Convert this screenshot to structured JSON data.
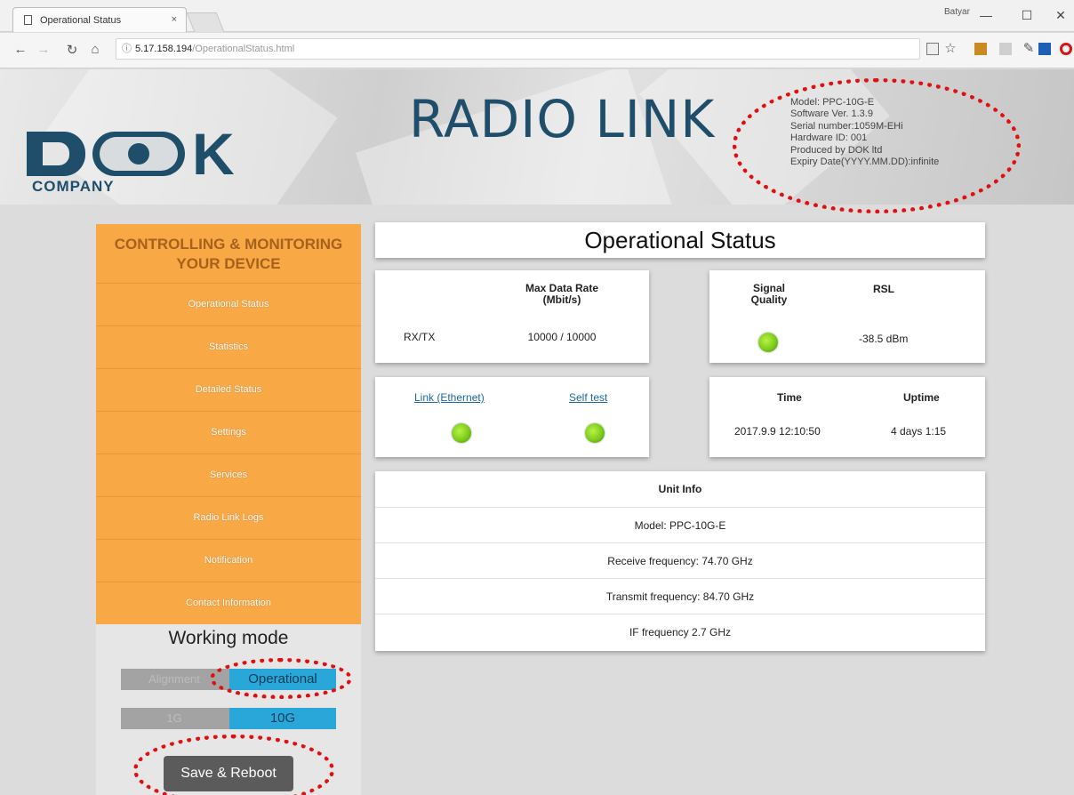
{
  "browser": {
    "tab_title": "Operational Status",
    "tab_close": "×",
    "user_name": "Batyar",
    "url_host": "5.17.158.194",
    "url_path": "/OperationalStatus.html",
    "info_icon": "ⓘ"
  },
  "header": {
    "logo_letter": "K",
    "logo_company": "COMPANY",
    "title": "RADIO LINK",
    "model_info": [
      "Model: PPC-10G-E",
      "Software Ver. 1.3.9",
      "Serial number:1059M-EHi",
      "Hardware ID: 001",
      "Produced by DOK ltd",
      "Expiry Date(YYYY.MM.DD):infinite"
    ]
  },
  "sidebar": {
    "heading_line1": "CONTROLLING & MONITORING",
    "heading_line2": "YOUR DEVICE",
    "items": [
      {
        "label": "Operational Status"
      },
      {
        "label": "Statistics"
      },
      {
        "label": "Detailed Status"
      },
      {
        "label": "Settings"
      },
      {
        "label": "Services"
      },
      {
        "label": "Radio Link Logs"
      },
      {
        "label": "Notification"
      },
      {
        "label": "Contact Information"
      }
    ]
  },
  "working_mode": {
    "title": "Working mode",
    "mode_left": "Alignment",
    "mode_right": "Operational",
    "rate_left": "1G",
    "rate_right": "10G",
    "save_label": "Save & Reboot"
  },
  "main": {
    "page_title": "Operational Status",
    "rate_card": {
      "header_line1": "Max Data Rate",
      "header_line2": "(Mbit/s)",
      "row_label": "RX/TX",
      "row_value": "10000 / 10000"
    },
    "signal_card": {
      "quality_line1": "Signal",
      "quality_line2": "Quality",
      "rsl_label": "RSL",
      "rsl_value": "-38.5 dBm"
    },
    "link_card": {
      "link_label": "Link (Ethernet)",
      "selftest_label": "Self test"
    },
    "time_card": {
      "time_label": "Time",
      "uptime_label": "Uptime",
      "time_value": "2017.9.9 12:10:50",
      "uptime_value": "4 days 1:15"
    },
    "unit_info": {
      "title": "Unit Info",
      "rows": [
        "Model: PPC-10G-E",
        "Receive frequency: 74.70 GHz",
        "Transmit frequency: 84.70 GHz",
        "IF frequency 2.7 GHz"
      ]
    }
  },
  "colors": {
    "sidebar_bg": "#f8a845",
    "brand_blue": "#1f4e6b",
    "toggle_active": "#28a7d8",
    "led_green": "#7ccc1c",
    "annotation_red": "#e01010"
  }
}
